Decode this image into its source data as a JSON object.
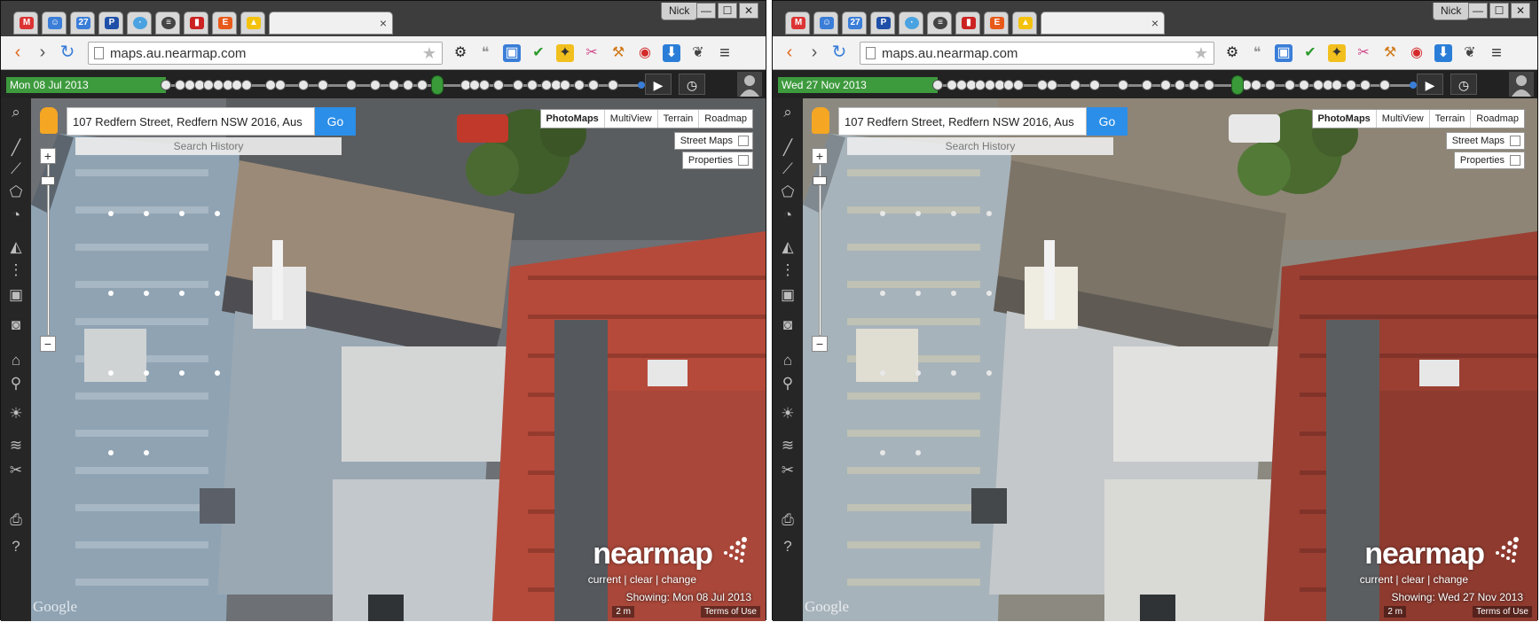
{
  "browser": {
    "url": "maps.au.nearmap.com",
    "user": "Nick",
    "tabs": [
      "M",
      "People",
      "27",
      "P",
      "Proxy",
      "Feed",
      "Ext",
      "E",
      "Drive"
    ],
    "active_tab_close": "×",
    "window_buttons": [
      "—",
      "☐",
      "✕"
    ]
  },
  "map_app": {
    "search_address": "107 Redfern Street, Redfern NSW 2016, Aus",
    "go_label": "Go",
    "search_history": "Search History",
    "map_types": [
      "PhotoMaps",
      "MultiView",
      "Terrain",
      "Roadmap"
    ],
    "overlays": {
      "street_maps": "Street Maps",
      "properties": "Properties"
    },
    "logo": "nearmap",
    "tagline": "current | clear | change",
    "scale": "2 m",
    "terms": "Terms of Use",
    "google": "Google"
  },
  "panels": [
    {
      "date": "Mon 08 Jul 2013",
      "showing": "Showing: Mon 08 Jul 2013",
      "accent": "#4a8a3a"
    },
    {
      "date": "Wed 27 Nov 2013",
      "showing": "Showing: Wed 27 Nov 2013",
      "accent": "#4a8a3a"
    }
  ],
  "colors": {
    "timeline_green": "#3d9a3d",
    "go_blue": "#2b8ee8",
    "roof_grey": "#9fb0bd",
    "tile_red": "#b94c3e"
  },
  "icons": {
    "toolbar_extensions": [
      "gear-icon",
      "speech-icon",
      "screenshot-icon",
      "check-icon",
      "badge-icon",
      "scissors-icon",
      "tool-icon",
      "stop-icon",
      "download-icon",
      "leaf-icon",
      "menu-icon"
    ],
    "side_tools": [
      "search-icon",
      "line-icon",
      "polyline-icon",
      "polygon-icon",
      "compass-icon",
      "layers-icon",
      "share-icon",
      "cube-icon",
      "camera-icon",
      "home-icon",
      "pin-icon",
      "weather-icon",
      "stack-icon",
      "cut-icon",
      "print-icon",
      "help-icon"
    ]
  }
}
